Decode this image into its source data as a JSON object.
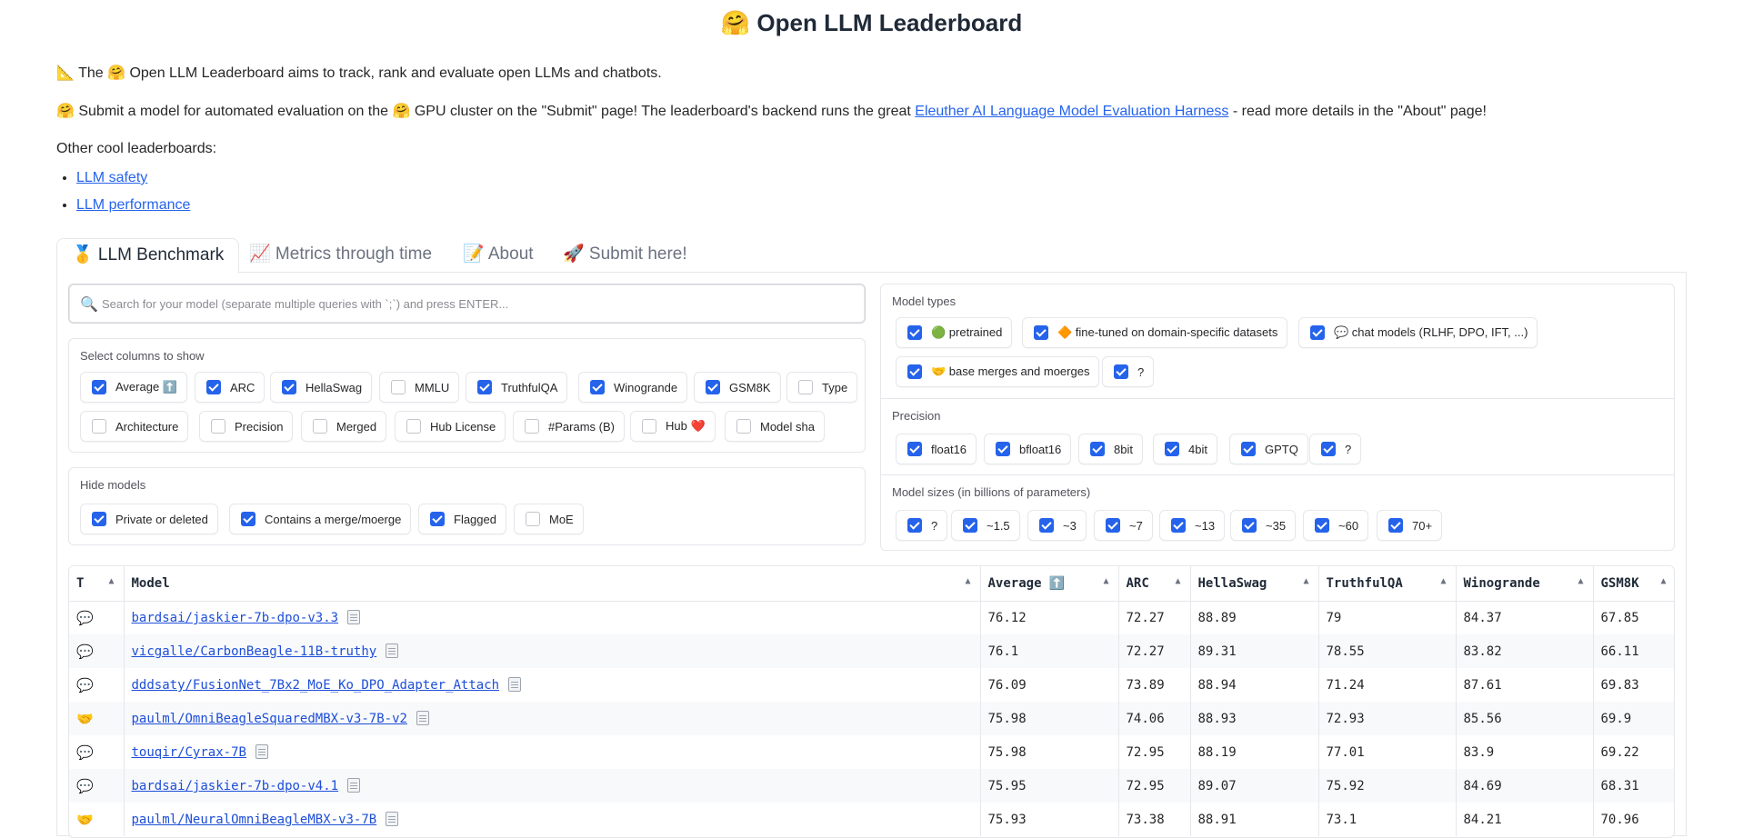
{
  "header": {
    "title": "🤗 Open LLM Leaderboard"
  },
  "intro": {
    "line1": "📐 The 🤗 Open LLM Leaderboard aims to track, rank and evaluate open LLMs and chatbots.",
    "line2_pre": "🤗 Submit a model for automated evaluation on the 🤗 GPU cluster on the \"Submit\" page! The leaderboard's backend runs the great ",
    "line2_link": "Eleuther AI Language Model Evaluation Harness",
    "line2_post": " - read more details in the \"About\" page!",
    "other_label": "Other cool leaderboards:",
    "links": [
      "LLM safety",
      "LLM performance"
    ]
  },
  "tabs": [
    "🥇 LLM Benchmark",
    "📈 Metrics through time",
    "📝 About",
    "🚀 Submit here!"
  ],
  "search": {
    "placeholder": "Search for your model (separate multiple queries with `;`) and press ENTER..."
  },
  "columns_box": {
    "title": "Select columns to show",
    "items": [
      {
        "label": "Average ⬆️",
        "checked": true
      },
      {
        "label": "ARC",
        "checked": true
      },
      {
        "label": "HellaSwag",
        "checked": true
      },
      {
        "label": "MMLU",
        "checked": false
      },
      {
        "label": "TruthfulQA",
        "checked": true
      },
      {
        "label": "Winogrande",
        "checked": true
      },
      {
        "label": "GSM8K",
        "checked": true
      },
      {
        "label": "Type",
        "checked": false
      },
      {
        "label": "Architecture",
        "checked": false
      },
      {
        "label": "Precision",
        "checked": false
      },
      {
        "label": "Merged",
        "checked": false
      },
      {
        "label": "Hub License",
        "checked": false
      },
      {
        "label": "#Params (B)",
        "checked": false
      },
      {
        "label": "Hub ❤️",
        "checked": false
      },
      {
        "label": "Model sha",
        "checked": false
      }
    ]
  },
  "hide_box": {
    "title": "Hide models",
    "items": [
      {
        "label": "Private or deleted",
        "checked": true
      },
      {
        "label": "Contains a merge/moerge",
        "checked": true
      },
      {
        "label": "Flagged",
        "checked": true
      },
      {
        "label": "MoE",
        "checked": false
      }
    ]
  },
  "types_box": {
    "title": "Model types",
    "items": [
      {
        "label": "🟢 pretrained",
        "checked": true
      },
      {
        "label": "🔶 fine-tuned on domain-specific datasets",
        "checked": true
      },
      {
        "label": "💬 chat models (RLHF, DPO, IFT, ...)",
        "checked": true
      },
      {
        "label": "🤝 base merges and moerges",
        "checked": true
      },
      {
        "label": "?",
        "checked": true
      }
    ]
  },
  "precision_box": {
    "title": "Precision",
    "items": [
      {
        "label": "float16",
        "checked": true
      },
      {
        "label": "bfloat16",
        "checked": true
      },
      {
        "label": "8bit",
        "checked": true
      },
      {
        "label": "4bit",
        "checked": true
      },
      {
        "label": "GPTQ",
        "checked": true
      },
      {
        "label": "?",
        "checked": true
      }
    ]
  },
  "sizes_box": {
    "title": "Model sizes (in billions of parameters)",
    "items": [
      {
        "label": "?",
        "checked": true
      },
      {
        "label": "~1.5",
        "checked": true
      },
      {
        "label": "~3",
        "checked": true
      },
      {
        "label": "~7",
        "checked": true
      },
      {
        "label": "~13",
        "checked": true
      },
      {
        "label": "~35",
        "checked": true
      },
      {
        "label": "~60",
        "checked": true
      },
      {
        "label": "70+",
        "checked": true
      }
    ]
  },
  "table": {
    "headers": [
      "T",
      "Model",
      "Average ⬆️",
      "ARC",
      "HellaSwag",
      "TruthfulQA",
      "Winogrande",
      "GSM8K"
    ],
    "rows": [
      {
        "t": "💬",
        "model": "bardsai/jaskier-7b-dpo-v3.3",
        "vals": [
          "76.12",
          "72.27",
          "88.89",
          "79",
          "84.37",
          "67.85"
        ]
      },
      {
        "t": "💬",
        "model": "vicgalle/CarbonBeagle-11B-truthy",
        "vals": [
          "76.1",
          "72.27",
          "89.31",
          "78.55",
          "83.82",
          "66.11"
        ]
      },
      {
        "t": "💬",
        "model": "dddsaty/FusionNet_7Bx2_MoE_Ko_DPO_Adapter_Attach",
        "vals": [
          "76.09",
          "73.89",
          "88.94",
          "71.24",
          "87.61",
          "69.83"
        ]
      },
      {
        "t": "🤝",
        "model": "paulml/OmniBeagleSquaredMBX-v3-7B-v2",
        "vals": [
          "75.98",
          "74.06",
          "88.93",
          "72.93",
          "85.56",
          "69.9"
        ]
      },
      {
        "t": "💬",
        "model": "touqir/Cyrax-7B",
        "vals": [
          "75.98",
          "72.95",
          "88.19",
          "77.01",
          "83.9",
          "69.22"
        ]
      },
      {
        "t": "💬",
        "model": "bardsai/jaskier-7b-dpo-v4.1",
        "vals": [
          "75.95",
          "72.95",
          "89.07",
          "75.92",
          "84.69",
          "68.31"
        ]
      },
      {
        "t": "🤝",
        "model": "paulml/NeuralOmniBeagleMBX-v3-7B",
        "vals": [
          "75.93",
          "73.38",
          "88.91",
          "73.1",
          "84.21",
          "70.96"
        ]
      }
    ]
  }
}
